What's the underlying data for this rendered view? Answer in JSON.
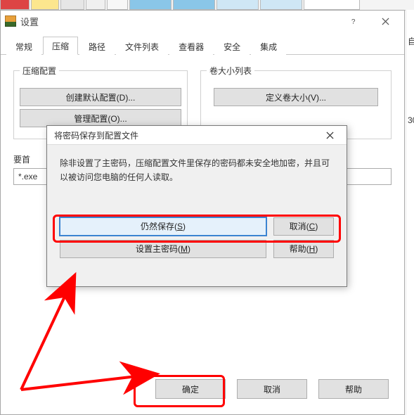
{
  "bg": {
    "right_sliver_top": "自",
    "right_sliver_mid": "30"
  },
  "settings": {
    "title": "设置",
    "tabs": {
      "general": "常规",
      "compress": "压缩",
      "path": "路径",
      "filelist": "文件列表",
      "viewer": "查看器",
      "security": "安全",
      "integrate": "集成"
    },
    "compress_group": {
      "legend": "压缩配置",
      "create_default": "创建默认配置(D)...",
      "manage": "管理配置(O)..."
    },
    "volume_group": {
      "legend": "卷大小列表",
      "define_size": "定义卷大小(V)..."
    },
    "pref_label": "要首",
    "pref_value": "*.exe",
    "actions": {
      "ok": "确定",
      "cancel": "取消",
      "help": "帮助"
    }
  },
  "modal": {
    "title": "将密码保存到配置文件",
    "message": "除非设置了主密码，压缩配置文件里保存的密码都未安全地加密，并且可以被访问您电脑的任何人读取。",
    "still_save": "仍然保存(",
    "still_save_k": "S",
    "still_save_e": ")",
    "cancel": "取消(",
    "cancel_k": "C",
    "cancel_e": ")",
    "set_master": "设置主密码(",
    "set_master_k": "M",
    "set_master_e": ")",
    "help": "帮助(",
    "help_k": "H",
    "help_e": ")"
  }
}
